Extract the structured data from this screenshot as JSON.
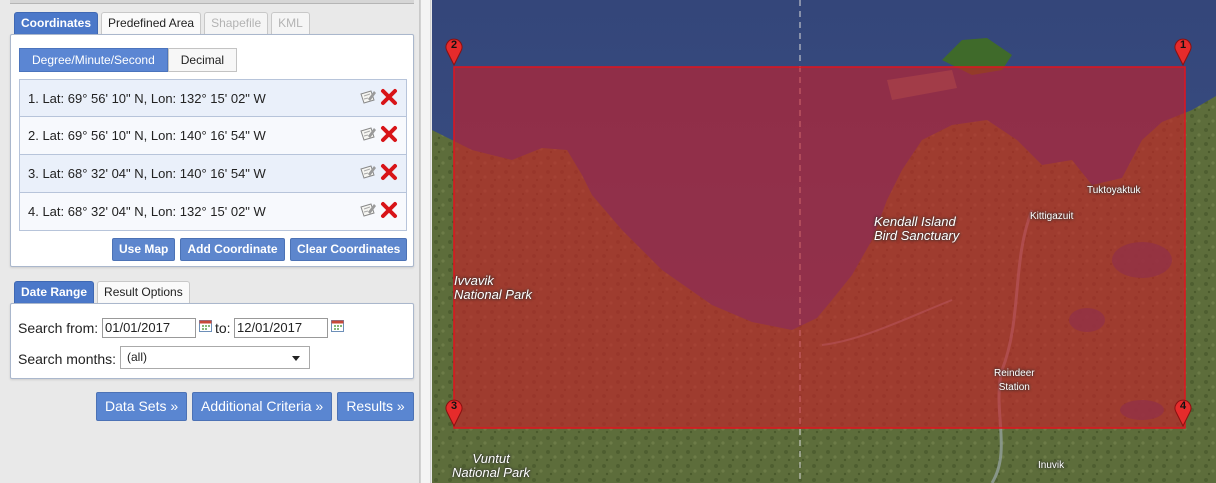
{
  "coord_tabs": [
    {
      "label": "Coordinates",
      "state": "active"
    },
    {
      "label": "Predefined Area",
      "state": "normal"
    },
    {
      "label": "Shapefile",
      "state": "disabled"
    },
    {
      "label": "KML",
      "state": "disabled"
    }
  ],
  "format_toggle": {
    "dms": "Degree/Minute/Second",
    "decimal": "Decimal",
    "selected": "dms"
  },
  "coordinates": [
    {
      "text": "1.  Lat: 69° 56' 10\" N, Lon: 132° 15' 02\" W"
    },
    {
      "text": "2.  Lat: 69° 56' 10\" N, Lon: 140° 16' 54\" W"
    },
    {
      "text": "3.  Lat: 68° 32' 04\" N, Lon: 140° 16' 54\" W"
    },
    {
      "text": "4.  Lat: 68° 32' 04\" N, Lon: 132° 15' 02\" W"
    }
  ],
  "coord_actions": {
    "use_map": "Use Map",
    "add": "Add Coordinate",
    "clear": "Clear Coordinates"
  },
  "date_tabs": [
    {
      "label": "Date Range",
      "state": "active"
    },
    {
      "label": "Result Options",
      "state": "normal"
    }
  ],
  "date_range": {
    "from_label": "Search from:",
    "from_value": "01/01/2017",
    "to_label": "to:",
    "to_value": "12/01/2017",
    "months_label": "Search months:",
    "months_value": "(all)"
  },
  "nav_buttons": {
    "data_sets": "Data Sets »",
    "additional": "Additional Criteria »",
    "results": "Results »"
  },
  "map": {
    "labels": {
      "ivvavik": "Ivvavik\nNational Park",
      "kendall": "Kendall Island\nBird Sanctuary",
      "vuntut": "Vuntut\nNational Park",
      "tuktoyaktuk": "Tuktoyaktuk",
      "kittigazuit": "Kittigazuit",
      "reindeer": "Reindeer\nStation",
      "inuvik": "Inuvik"
    },
    "markers": [
      "1",
      "2",
      "3",
      "4"
    ],
    "colors": {
      "polygon_fill": "#c81e28",
      "polygon_stroke": "#e0141e",
      "ocean": "#3b4e7d",
      "land": "#5d6e3a"
    }
  },
  "icons": {
    "edit": "edit-icon",
    "delete": "delete-icon",
    "calendar": "calendar-icon",
    "marker": "map-marker-icon"
  }
}
